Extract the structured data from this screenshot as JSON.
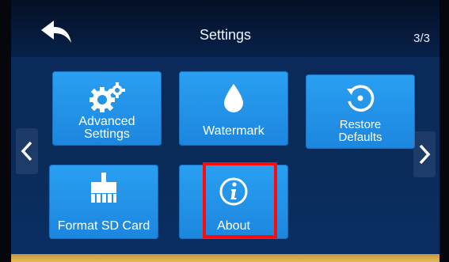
{
  "header": {
    "title": "Settings",
    "page_indicator": "3/3"
  },
  "tiles": [
    {
      "label": "Advanced\nSettings",
      "icon": "gears-icon"
    },
    {
      "label": "Watermark",
      "icon": "water-drop-icon"
    },
    {
      "label": "Restore\nDefaults",
      "icon": "restore-icon"
    },
    {
      "label": "Format SD Card",
      "icon": "brush-icon"
    },
    {
      "label": "About",
      "icon": "info-icon"
    }
  ],
  "nav": {
    "prev_icon": "chevron-left-icon",
    "next_icon": "chevron-right-icon",
    "back_icon": "back-arrow-icon"
  },
  "highlight": {
    "target": "About",
    "color": "#ff0a0a"
  }
}
